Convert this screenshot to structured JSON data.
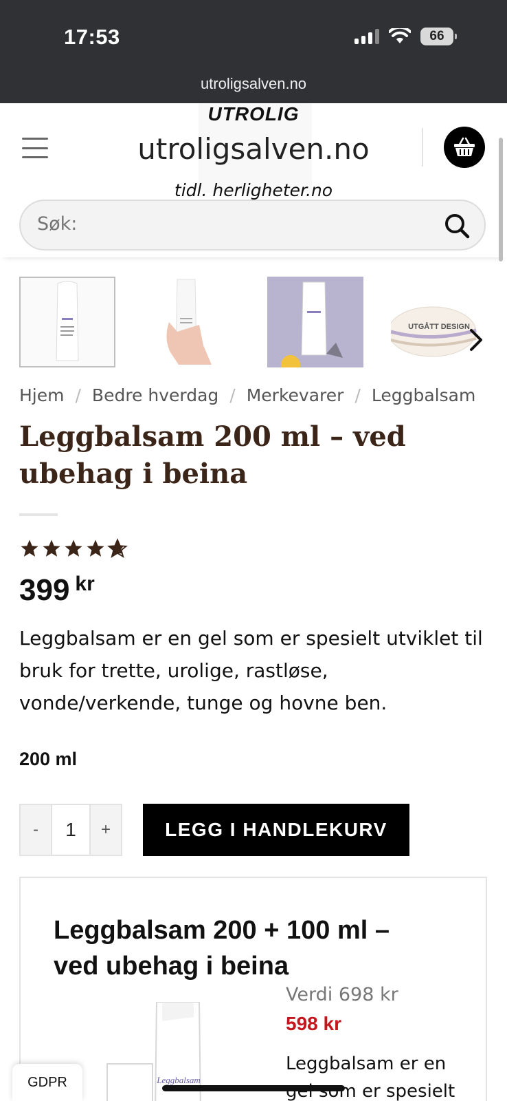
{
  "status_bar": {
    "time": "17:53",
    "battery": "66"
  },
  "browser": {
    "url": "utroligsalven.no"
  },
  "header": {
    "logo": "UTROLIG",
    "site_name": "utroligsalven.no",
    "tagline": "tidl. herligheter.no",
    "search_placeholder": "Søk:"
  },
  "gallery": {
    "thumbnails": [
      {
        "icon": "leggbalsam-bottle-image"
      },
      {
        "icon": "hand-holding-bottle-image"
      },
      {
        "icon": "bottle-lavender-image"
      },
      {
        "icon": "jar-image",
        "label": "UTGÅTT DESIGN"
      }
    ]
  },
  "breadcrumb": [
    "Hjem",
    "Bedre hverdag",
    "Merkevarer",
    "Leggbalsam"
  ],
  "product": {
    "title": "Leggbalsam 200 ml – ved ubehag i beina",
    "rating": 4.5,
    "price_amount": "399",
    "price_currency": "kr",
    "description": "Leggbalsam er en gel som er spesielt utviklet til bruk for trette, urolige, rastløse, vonde/verkende, tunge og hovne ben.",
    "size": "200 ml",
    "quantity": "1",
    "qty_minus": "-",
    "qty_plus": "+",
    "add_to_cart": "LEGG I HANDLEKURV"
  },
  "bundle": {
    "title": "Leggbalsam 200 + 100 ml – ved ubehag i beina",
    "old_price": "Verdi 698 kr",
    "new_price": "598 kr",
    "description": "Leggbalsam er en gel som er spesielt",
    "image_label": "Leggbalsam"
  },
  "gdpr": "GDPR",
  "colors": {
    "title": "#3b2418",
    "sale_price": "#c4161c",
    "button": "#000000"
  }
}
